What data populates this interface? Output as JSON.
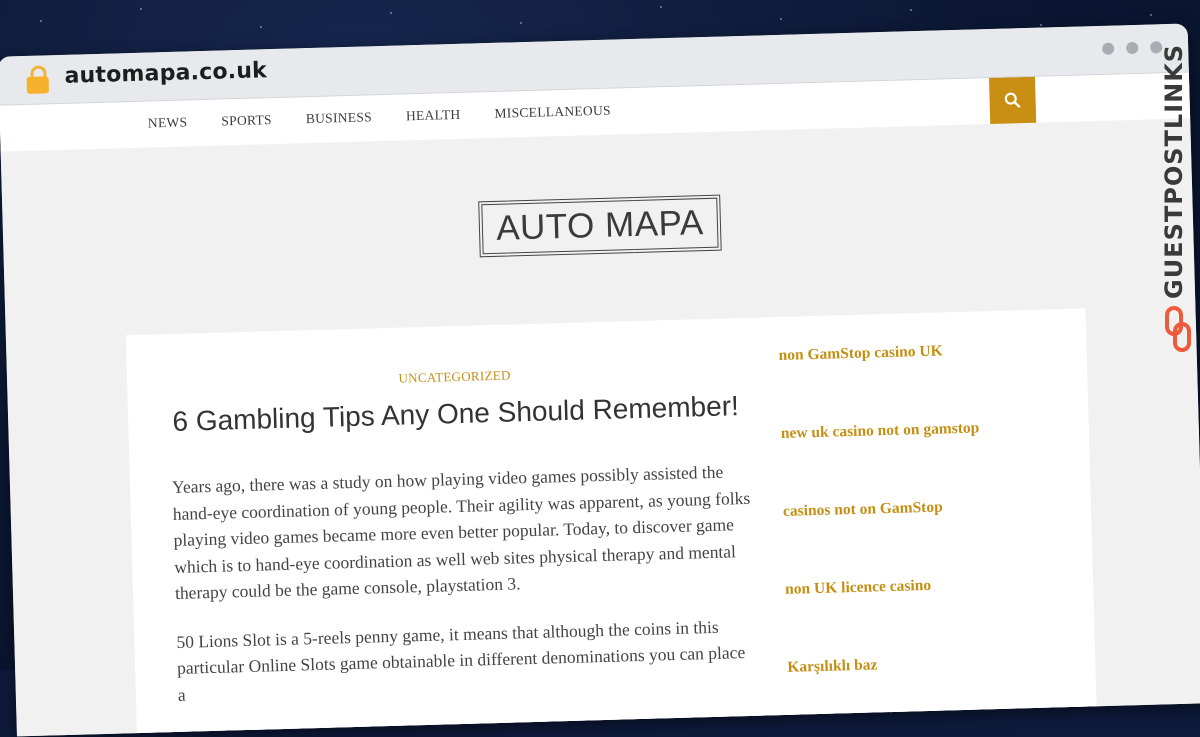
{
  "browser": {
    "url": "automapa.co.uk"
  },
  "nav": {
    "items": [
      "NEWS",
      "SPORTS",
      "BUSINESS",
      "HEALTH",
      "MISCELLANEOUS"
    ]
  },
  "site": {
    "logo": "AUTO MAPA"
  },
  "post": {
    "category": "UNCATEGORIZED",
    "title": "6 Gambling Tips Any One Should Remember!",
    "paragraphs": [
      "Years ago, there was a study on how playing video games possibly assisted the hand-eye coordination of young people. Their agility was apparent, as young folks playing video games became more even better popular. Today, to discover game which is to hand-eye coordination as well web sites physical therapy and mental therapy could be the game console, playstation 3.",
      "50 Lions Slot is a 5-reels penny game, it means that although the coins in this particular Online Slots game obtainable in different denominations you can place a"
    ]
  },
  "sidebar": {
    "links": [
      "non GamStop casino UK",
      "new uk casino not on gamstop",
      "casinos not on GamStop",
      "non UK licence casino",
      "Karşılıklı baz"
    ]
  },
  "watermark": {
    "text": "GUESTPOSTLINKS"
  },
  "colors": {
    "accent": "#c98f12",
    "link": "#c48f13",
    "lock": "#f6b12d",
    "watermark_logo": "#f05a3c"
  },
  "icons": [
    "lock-icon",
    "search-icon",
    "guestpostlinks-logo-icon"
  ]
}
